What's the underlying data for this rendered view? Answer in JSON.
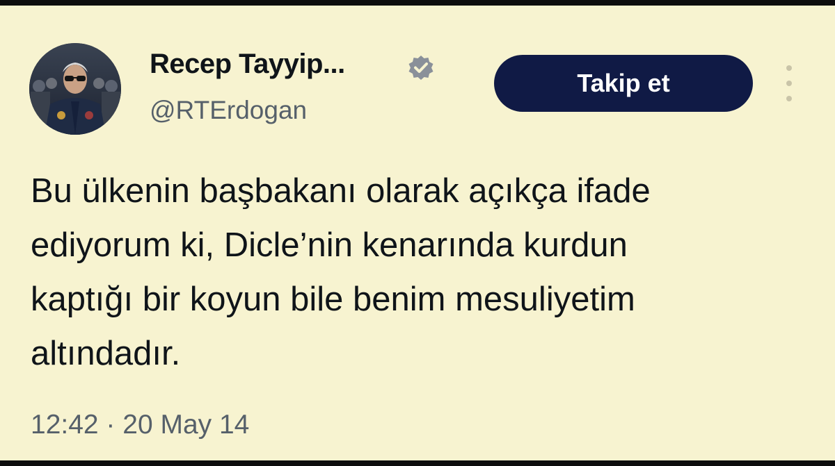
{
  "author": {
    "display_name": "Recep Tayyip...",
    "handle": "@RTErdogan",
    "verified": true
  },
  "actions": {
    "follow_label": "Takip et"
  },
  "tweet": {
    "lines": [
      "Bu ülkenin başbakanı olarak açıkça ifade",
      "ediyorum ki, Dicle’nin kenarında kurdun",
      "kaptığı bir koyun bile benim mesuliyetim",
      "altındadır."
    ],
    "timestamp": "12:42 · 20 May 14"
  },
  "icons": {
    "verified": "verified-badge-icon",
    "more": "more-vertical-icon"
  },
  "colors": {
    "background": "#f7f3d0",
    "follow_button": "#101a45",
    "text_primary": "#0f1419",
    "text_secondary": "#56606a"
  }
}
